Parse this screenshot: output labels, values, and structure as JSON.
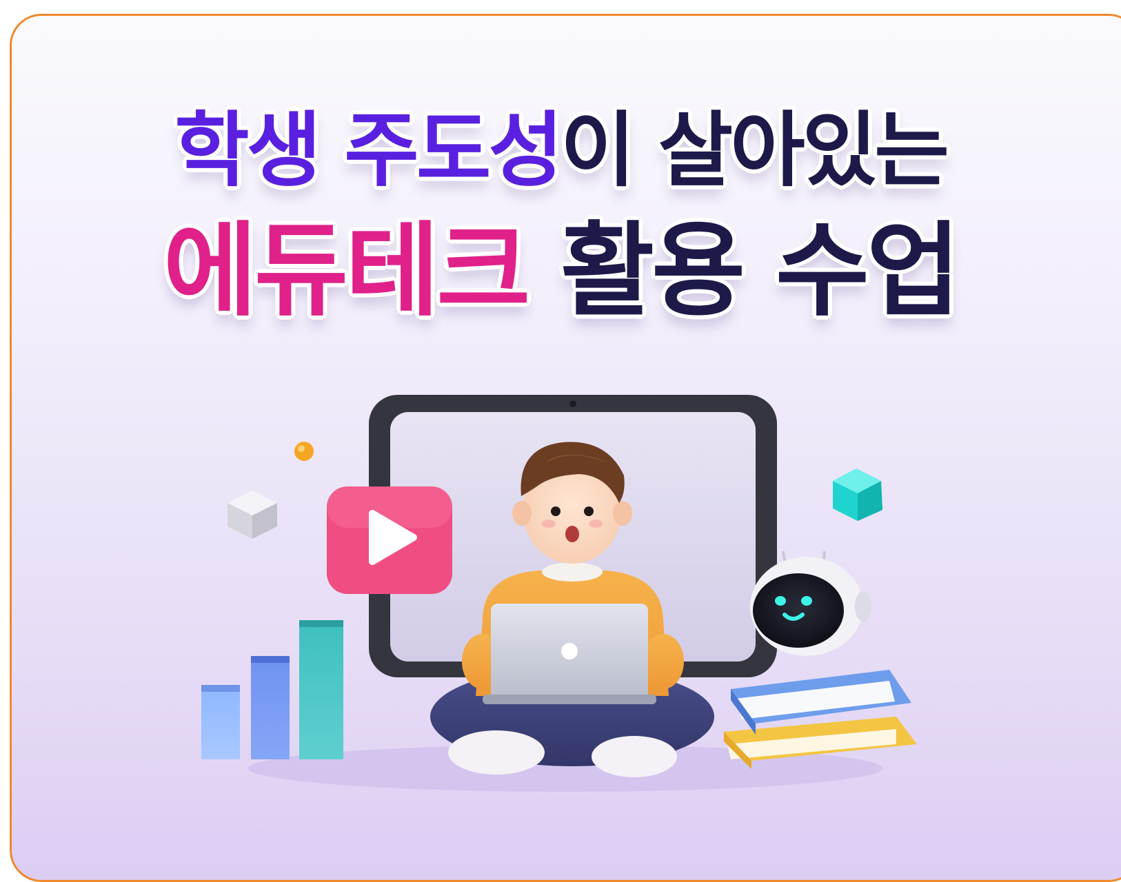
{
  "banner": {
    "title_line1": {
      "part1": "학생 주도성",
      "part2": "이 살아있는"
    },
    "title_line2": {
      "part1": "에듀테크",
      "part2": " 활용 수업"
    }
  },
  "colors": {
    "border": "#f0892a",
    "title_purple": "#5a20e0",
    "title_pink": "#e0218a",
    "title_navy": "#1d1a4a",
    "background_top": "#fafafd",
    "background_bottom": "#dccdf3"
  },
  "icons": [
    "tablet-icon",
    "play-button-icon",
    "bar-chart-icon",
    "robot-icon",
    "books-icon",
    "laptop-icon",
    "student-character",
    "cube-icon",
    "gem-icon"
  ]
}
